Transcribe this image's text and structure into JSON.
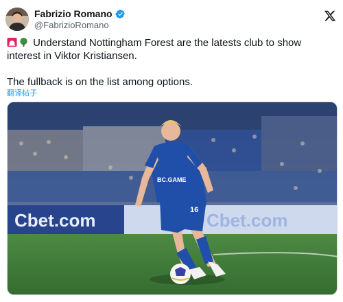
{
  "author": {
    "display_name": "Fabrizio Romano",
    "handle": "@FabrizioRomano",
    "verified": true,
    "avatar_icon": "profile-photo"
  },
  "tweet": {
    "emojis": [
      "siren-emoji",
      "tree-emoji"
    ],
    "line1": "Understand Nottingham Forest are the latests club to show",
    "line2": "interest in Viktor Kristiansen.",
    "line3": "The fullback is on the list among options.",
    "translate_label": "翻译帖子"
  },
  "photo": {
    "kit_sponsor": "BC.GAME",
    "shirt_number": "16",
    "ad_boards": [
      "Cbet.com",
      "Cbet.com"
    ],
    "colors": {
      "kit": "#1f4fa8",
      "pitch": "#3f7d3a",
      "stands": "#2b4a8a"
    }
  },
  "brand": {
    "accent": "#1d9bf0"
  }
}
